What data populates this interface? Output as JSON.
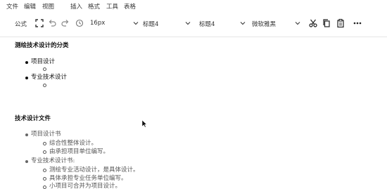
{
  "menubar": {
    "items": [
      "文件",
      "编辑",
      "视图",
      "插入",
      "格式",
      "工具",
      "表格"
    ]
  },
  "toolbar": {
    "formula_label": "公式",
    "font_size": "16px",
    "block_format_1": "标题4",
    "block_format_2": "标题4",
    "font_family": "微软雅黑",
    "icons": [
      "fullscreen-icon",
      "undo-icon",
      "redo-icon",
      "clock-icon",
      "cut-icon",
      "copy-icon",
      "paste-icon",
      "more-icon"
    ]
  },
  "document": {
    "section1": {
      "heading": "测绘技术设计的分类",
      "items": [
        "项目设计",
        "专业技术设计"
      ]
    },
    "section2": {
      "heading": "技术设计文件",
      "items": [
        {
          "label": "项目设计书",
          "sub": [
            "综合性整体设计。",
            "由承担项目单位编写。"
          ]
        },
        {
          "label": "专业技术设计书:",
          "sub": [
            "测绘专业活动设计，是具体设计。",
            "具体承担专业任务单位编写。",
            "小项目可合并为项目设计。"
          ]
        }
      ]
    }
  }
}
